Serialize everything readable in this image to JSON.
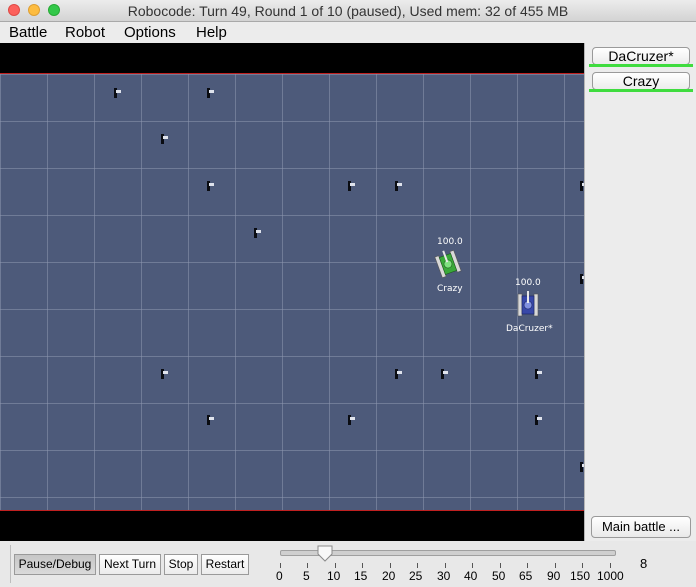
{
  "window": {
    "title": "Robocode: Turn 49, Round 1 of 10 (paused), Used mem: 32 of 455 MB"
  },
  "menu": {
    "items": [
      "Battle",
      "Robot",
      "Options",
      "Help"
    ]
  },
  "robots": [
    {
      "name": "Crazy",
      "energy": "100.0",
      "body_color": "#3aa83a"
    },
    {
      "name": "DaCruzer*",
      "energy": "100.0",
      "body_color": "#3848a8"
    }
  ],
  "sidepanel": {
    "robot_buttons": [
      "DaCruzer*",
      "Crazy"
    ],
    "main_battle_button": "Main battle ..."
  },
  "controls": {
    "pause_debug": "Pause/Debug",
    "next_turn": "Next Turn",
    "stop": "Stop",
    "restart": "Restart"
  },
  "speed_slider": {
    "tick_labels": [
      "0",
      "5",
      "10",
      "15",
      "20",
      "25",
      "30",
      "40",
      "50",
      "65",
      "90",
      "150",
      "1000"
    ],
    "tps_value": "8"
  },
  "colors": {
    "arena": "#4d5a7a",
    "border": "#c02020",
    "selected_highlight": "#3fdc3f"
  }
}
